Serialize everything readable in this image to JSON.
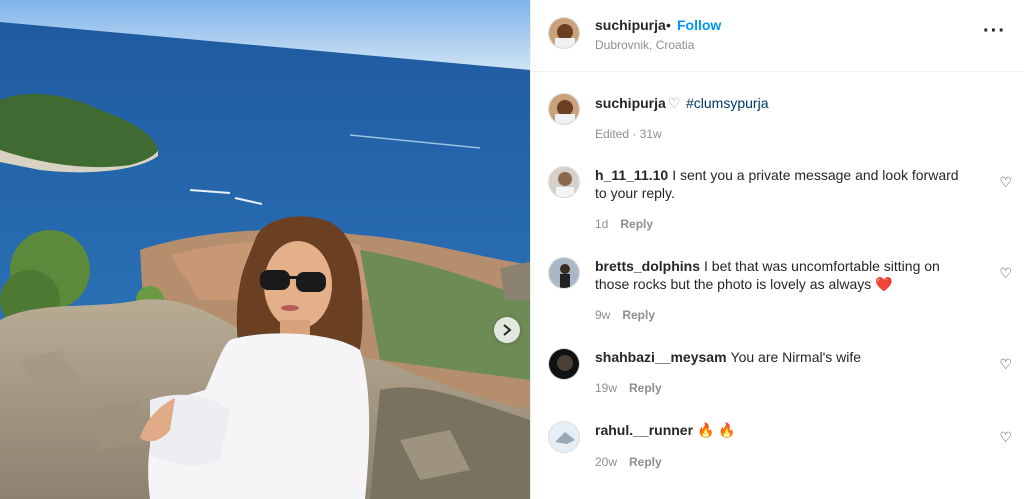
{
  "post": {
    "author": "suchipurja",
    "follow_label": "Follow",
    "separator": "•",
    "location": "Dubrovnik, Croatia",
    "more_icon": "more-horizontal-icon",
    "caption": {
      "user": "suchipurja",
      "heart": "♡",
      "text": "#clumsypurja"
    },
    "edited": "Edited · 31w"
  },
  "comments": [
    {
      "user": "h_11_11.10",
      "text": "I sent you a private message and look forward to your reply.",
      "age": "1d",
      "reply": "Reply"
    },
    {
      "user": "bretts_dolphins",
      "text": "I bet that was uncomfortable sitting on those rocks but the photo is lovely as always",
      "emoji": "❤️",
      "age": "9w",
      "reply": "Reply"
    },
    {
      "user": "shahbazi__meysam",
      "text": "You are Nirmal's wife",
      "age": "19w",
      "reply": "Reply"
    },
    {
      "user": "rahul.__runner",
      "text": "🔥 🔥",
      "age": "20w",
      "reply": "Reply"
    }
  ],
  "colors": {
    "link": "#0095f6",
    "hashtag": "#00376b",
    "muted": "#8e8e8e",
    "heart_red": "#ed4956"
  }
}
